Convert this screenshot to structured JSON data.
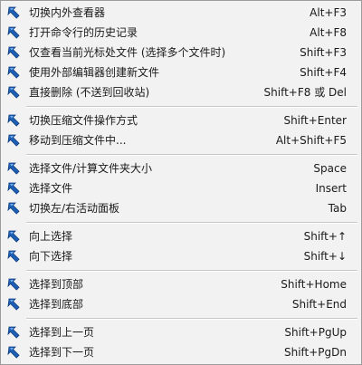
{
  "menu": {
    "icon": "arrow-up-left-icon",
    "icon_color": "#1f5fb3",
    "items": [
      {
        "label": "切换内外查看器",
        "shortcut": "Alt+F3"
      },
      {
        "label": "打开命令行的历史记录",
        "shortcut": "Alt+F8"
      },
      {
        "label": "仅查看当前光标处文件 (选择多个文件时)",
        "shortcut": "Shift+F3"
      },
      {
        "label": "使用外部编辑器创建新文件",
        "shortcut": "Shift+F4"
      },
      {
        "label": "直接删除 (不送到回收站)",
        "shortcut": "Shift+F8 或 Del"
      },
      {
        "label": "切换压缩文件操作方式",
        "shortcut": "Shift+Enter"
      },
      {
        "label": "移动到压缩文件中...",
        "shortcut": "Alt+Shift+F5"
      },
      {
        "label": "选择文件/计算文件夹大小",
        "shortcut": "Space"
      },
      {
        "label": "选择文件",
        "shortcut": "Insert"
      },
      {
        "label": "切换左/右活动面板",
        "shortcut": "Tab"
      },
      {
        "label": "向上选择",
        "shortcut": "Shift+↑"
      },
      {
        "label": "向下选择",
        "shortcut": "Shift+↓"
      },
      {
        "label": "选择到顶部",
        "shortcut": "Shift+Home"
      },
      {
        "label": "选择到底部",
        "shortcut": "Shift+End"
      },
      {
        "label": "选择到上一页",
        "shortcut": "Shift+PgUp"
      },
      {
        "label": "选择到下一页",
        "shortcut": "Shift+PgDn"
      }
    ]
  }
}
